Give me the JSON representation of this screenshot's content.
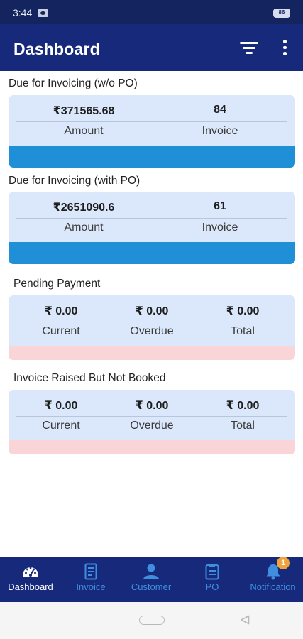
{
  "status_bar": {
    "time": "3:44",
    "battery": "86"
  },
  "app_bar": {
    "title": "Dashboard",
    "filter_icon": "filter-icon",
    "more_icon": "more-vert-icon"
  },
  "sections": {
    "due_wo_po": {
      "title": "Due for Invoicing (w/o PO)",
      "amount_value": "₹371565.68",
      "amount_label": "Amount",
      "invoice_value": "84",
      "invoice_label": "Invoice",
      "bar_color": "#1f8fd8"
    },
    "due_with_po": {
      "title": "Due for Invoicing (with PO)",
      "amount_value": "₹2651090.6",
      "amount_label": "Amount",
      "invoice_value": "61",
      "invoice_label": "Invoice",
      "bar_color": "#1f8fd8"
    },
    "pending_payment": {
      "title": "Pending Payment",
      "current_value": "₹ 0.00",
      "current_label": "Current",
      "overdue_value": "₹ 0.00",
      "overdue_label": "Overdue",
      "total_value": "₹ 0.00",
      "total_label": "Total",
      "bar_color": "#fad5d8"
    },
    "raised_not_booked": {
      "title": "Invoice Raised But Not Booked",
      "current_value": "₹ 0.00",
      "current_label": "Current",
      "overdue_value": "₹ 0.00",
      "overdue_label": "Overdue",
      "total_value": "₹ 0.00",
      "total_label": "Total",
      "bar_color": "#fad5d8"
    }
  },
  "bottom_nav": {
    "items": [
      {
        "label": "Dashboard",
        "icon": "speedometer-icon",
        "active": true
      },
      {
        "label": "Invoice",
        "icon": "invoice-icon",
        "active": false
      },
      {
        "label": "Customer",
        "icon": "person-icon",
        "active": false
      },
      {
        "label": "PO",
        "icon": "clipboard-icon",
        "active": false
      },
      {
        "label": "Notification",
        "icon": "bell-icon",
        "active": false
      }
    ],
    "notification_badge": "1"
  },
  "colors": {
    "primary": "#16297a",
    "status_bar": "#13245e",
    "card_bg": "#dbe8fb",
    "inactive_nav": "#3f8ee0"
  }
}
